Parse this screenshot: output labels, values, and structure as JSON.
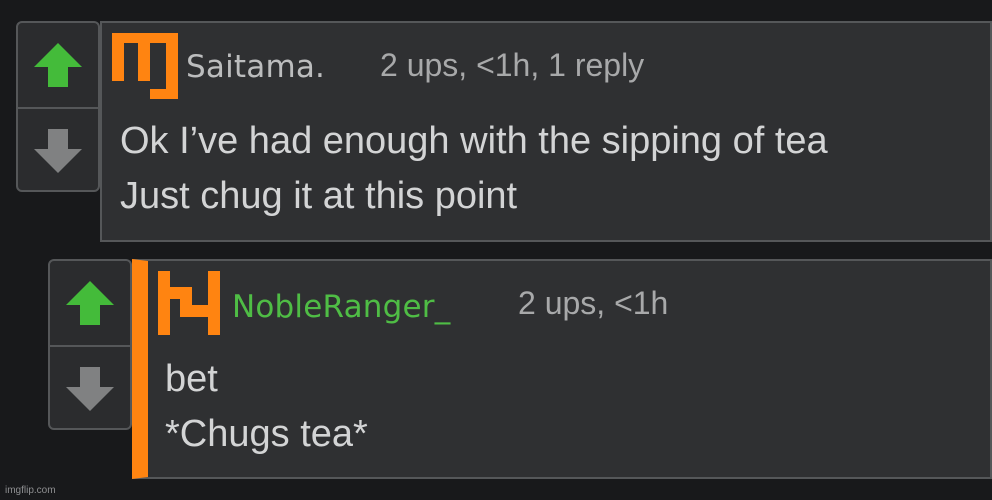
{
  "colors": {
    "background": "#18191b",
    "panel": "#2f3032",
    "border": "#555759",
    "upvote": "#44bb3a",
    "downvote": "#808182",
    "accent": "#ff8411",
    "reply_username": "#4fbd45",
    "parent_username": "#bcbdbe",
    "meta_text": "#a8a9aa",
    "body_text": "#d3d4d5"
  },
  "comments": [
    {
      "avatar_icon": "orange-pixel-glyph-icon",
      "username": "Saitama.",
      "meta": "2 ups, <1h, 1 reply",
      "body_lines": [
        "Ok I’ve had enough with the sipping of tea",
        "Just chug it at this point"
      ],
      "upvote_icon": "arrow-up-icon",
      "downvote_icon": "arrow-down-icon"
    },
    {
      "avatar_icon": "orange-pixel-glyph-icon",
      "username": "NobleRanger_",
      "meta": "2 ups, <1h",
      "body_lines": [
        "bet",
        "*Chugs tea*"
      ],
      "upvote_icon": "arrow-up-icon",
      "downvote_icon": "arrow-down-icon"
    }
  ],
  "watermark": "imgflip.com"
}
